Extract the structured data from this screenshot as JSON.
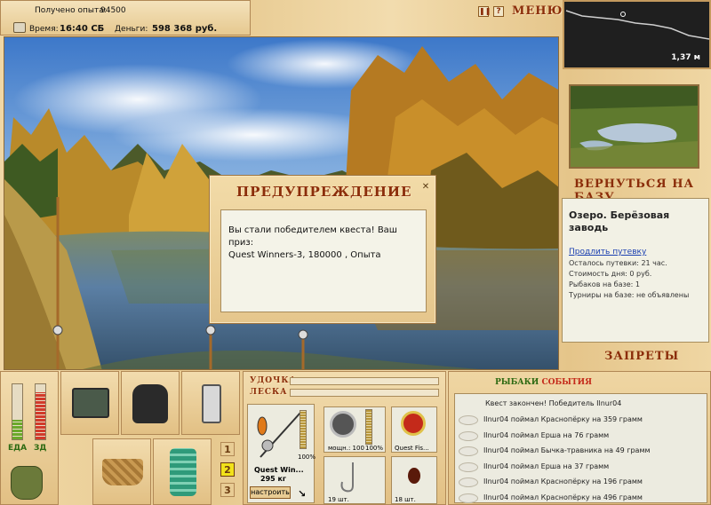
{
  "top": {
    "exp_label": "Получено опыта:",
    "exp_value": "94500",
    "time_label": "Время:",
    "time_value": "16:40 СБ",
    "money_label": "Деньги:",
    "money_value": "598 368 руб."
  },
  "menu": {
    "pause_icon": "pause-icon",
    "help_label": "?",
    "menu_label": "МЕНЮ"
  },
  "sonar": {
    "depth": "1,37 м"
  },
  "location": {
    "back_button": "ВЕРНУТЬСЯ НА БАЗУ",
    "name": "Озеро. Берёзовая заводь",
    "extend_link": "Продлить путевку",
    "lines": [
      "Осталось путевки: 21 час.",
      "Стоимость дня: 0 руб.",
      "Рыбаков на базе: 1",
      "Турниры на базе: не объявлены"
    ],
    "bans_button": "ЗАПРЕТЫ"
  },
  "dialog": {
    "title": "ПРЕДУПРЕЖДЕНИЕ",
    "close": "✕",
    "message_line1": "Вы стали победителем квеста! Ваш приз:",
    "message_line2": "Quest Winners-3, 180000 , Опыта"
  },
  "status": {
    "food_label": "ЕДА",
    "health_label": "ЗД",
    "food_level": 0.35,
    "health_level": 0.85
  },
  "tackle": {
    "rod_label": "УДОЧКА",
    "line_label": "ЛЕСКА",
    "rod_name": "Quest Win...",
    "rod_weight": "295 кг",
    "rod_percent": "100%",
    "reel_label": "мощн.: 100",
    "reel_percent": "100%",
    "lure_label": "Quest Fis...",
    "hook_count": "19 шт.",
    "bait_count": "18 шт.",
    "setup_button": "настроить",
    "slot_numbers": [
      "1",
      "2",
      "3"
    ],
    "active_slot": "2"
  },
  "events": {
    "title_part1": "РЫБАКИ",
    "title_part2": "СОБЫТИЯ",
    "header_line": "Квест закончен! Победитель Ilnur04",
    "rows": [
      "Ilnur04 поймал Краснопёрку на 359 грамм",
      "Ilnur04 поймал Ерша на 76 грамм",
      "Ilnur04 поймал Бычка-травника на 49 грамм",
      "Ilnur04 поймал Ерша на 37 грамм",
      "Ilnur04 поймал Краснопёрку на 196 грамм",
      "Ilnur04 поймал Краснопёрку на 496 грамм"
    ]
  },
  "colors": {
    "wood": "#e9cf9b",
    "title_red": "#8b2d0a",
    "link_blue": "#1a3fb0",
    "active_slot": "#f2e21a"
  }
}
